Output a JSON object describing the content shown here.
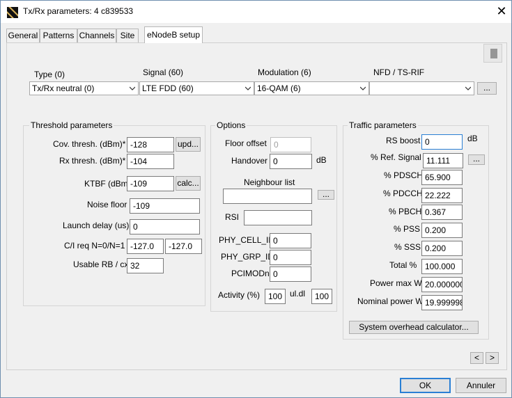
{
  "window": {
    "title": "Tx/Rx parameters: 4 c839533",
    "close_glyph": "✕"
  },
  "tabs": [
    {
      "label": "General"
    },
    {
      "label": "Patterns"
    },
    {
      "label": "Channels"
    },
    {
      "label": "Site"
    },
    {
      "label": "eNodeB setup",
      "active": true
    }
  ],
  "top_fields": {
    "type": {
      "label": "Type (0)",
      "value": "Tx/Rx neutral (0)"
    },
    "signal": {
      "label": "Signal (60)",
      "value": "LTE FDD (60)"
    },
    "modulation": {
      "label": "Modulation (6)",
      "value": "16-QAM (6)"
    },
    "nfd": {
      "label": "NFD / TS-RIF",
      "value": ""
    },
    "browse_label": "..."
  },
  "threshold": {
    "title": "Threshold parameters",
    "cov_label": "Cov. thresh. (dBm)*",
    "cov_value": "-128",
    "cov_button": "upd...",
    "rx_label": "Rx thresh. (dBm)*",
    "rx_value": "-104",
    "ktbf_label": "KTBF (dBm)",
    "ktbf_value": "-109",
    "ktbf_button": "calc...",
    "noise_label": "Noise floor",
    "noise_value": "-109",
    "launch_label": "Launch delay  (us)",
    "launch_value": "0",
    "ci_label": "C/I req N=0/N=1",
    "ci_value1": "-127.0",
    "ci_value2": "-127.0",
    "usable_label": "Usable RB / cx",
    "usable_value": "32"
  },
  "options": {
    "title": "Options",
    "floor_label": "Floor offset",
    "floor_value": "0",
    "handover_label": "Handover",
    "handover_value": "0",
    "handover_unit": "dB",
    "neighbour_label": "Neighbour list",
    "neighbour_value": "",
    "neighbour_button": "...",
    "rsi_label": "RSI",
    "rsi_value": "",
    "phy_cell_label": "PHY_CELL_ID",
    "phy_cell_value": "0",
    "phy_grp_label": "PHY_GRP_ID",
    "phy_grp_value": "0",
    "pcimod_label": "PCIMODn",
    "pcimod_value": "0",
    "activity_label": "Activity (%)",
    "activity_ul": "100",
    "uldl_label": "ul.dl",
    "activity_dl": "100"
  },
  "traffic": {
    "title": "Traffic parameters",
    "rs_boost_label": "RS boost",
    "rs_boost_value": "0",
    "rs_boost_unit": "dB",
    "ref_signal_label": "% Ref. Signal",
    "ref_signal_value": "11.111",
    "ref_signal_button": "...",
    "pdsch_label": "% PDSCH",
    "pdsch_value": "65.900",
    "pdcch_label": "% PDCCH",
    "pdcch_value": "22.222",
    "pbch_label": "% PBCH",
    "pbch_value": "0.367",
    "pss_label": "% PSS",
    "pss_value": "0.200",
    "sss_label": "% SSS",
    "sss_value": "0.200",
    "total_label": "Total %",
    "total_value": "100.000",
    "power_max_label": "Power max W",
    "power_max_value": "20.000000",
    "nominal_label": "Nominal power W",
    "nominal_value": "19.999998",
    "overhead_button": "System overhead calculator..."
  },
  "nav": {
    "prev": "<",
    "next": ">"
  },
  "footer": {
    "ok": "OK",
    "cancel": "Annuler"
  }
}
